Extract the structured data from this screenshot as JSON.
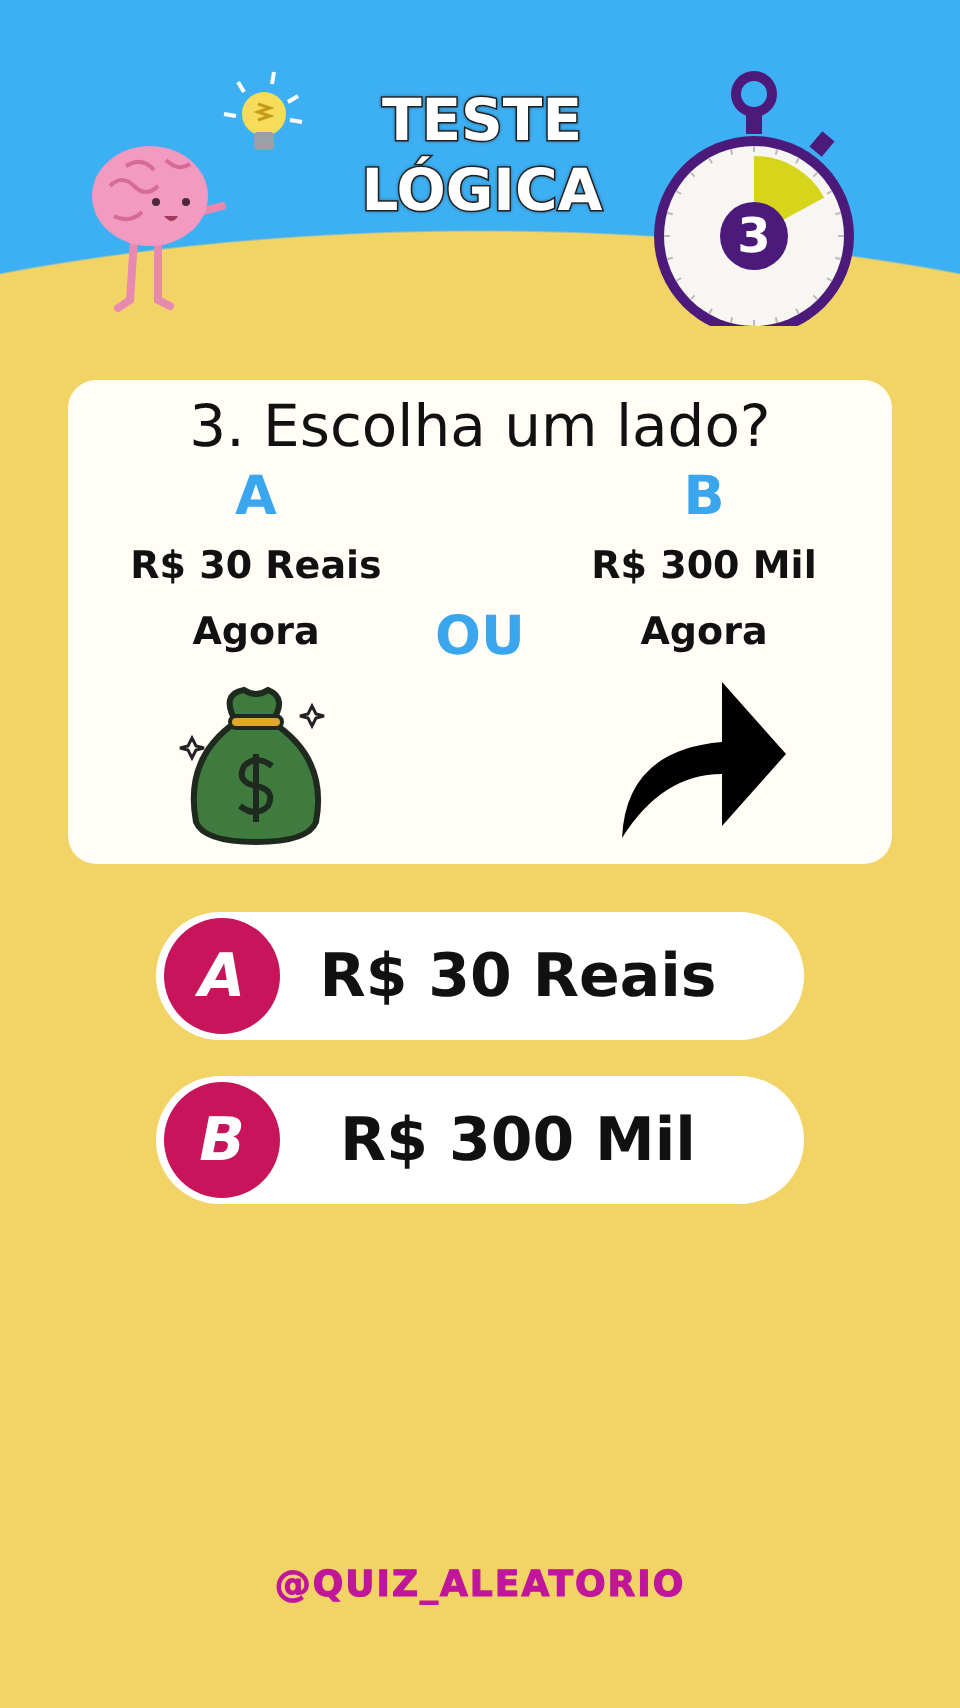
{
  "header": {
    "title_lines": [
      "TESTE",
      "LÓGICA"
    ]
  },
  "timer": {
    "number": "3"
  },
  "question": {
    "text": "3. Escolha um lado?",
    "separator": "OU",
    "sides": [
      {
        "letter": "A",
        "lines": [
          "R$ 30 Reais",
          "Agora"
        ],
        "kind": "money-bag"
      },
      {
        "letter": "B",
        "lines": [
          "R$ 300 Mil",
          "Agora"
        ],
        "kind": "arrow"
      }
    ]
  },
  "answers": [
    {
      "letter": "A",
      "text": "R$ 30 Reais"
    },
    {
      "letter": "B",
      "text": "R$ 300 Mil"
    }
  ],
  "handle": "@QUIZ_ALEATORIO"
}
